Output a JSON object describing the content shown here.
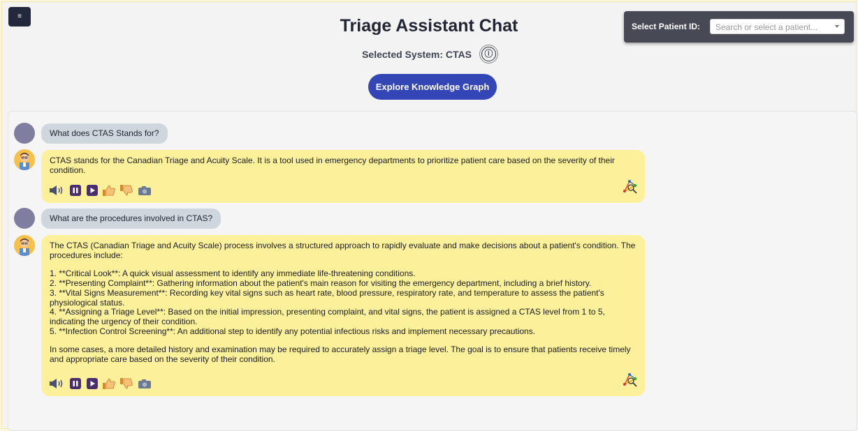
{
  "header": {
    "menu_label": "≡",
    "title": "Triage Assistant Chat",
    "system_label": "Selected System: CTAS",
    "info_glyph": "ⓘ",
    "kg_button": "Explore Knowledge Graph"
  },
  "patient": {
    "label": "Select Patient ID:",
    "placeholder": "Search or select a patient..."
  },
  "messages": [
    {
      "role": "user",
      "text": "What does CTAS Stands for?"
    },
    {
      "role": "assistant",
      "lines": [
        "CTAS stands for the Canadian Triage and Acuity Scale. It is a tool used in emergency departments to prioritize patient care based on the severity of their condition."
      ]
    },
    {
      "role": "user",
      "text": "What are the procedures involved in CTAS?"
    },
    {
      "role": "assistant",
      "intro": "The CTAS (Canadian Triage and Acuity Scale) process involves a structured approach to rapidly evaluate and make decisions about a patient's condition. The procedures include:",
      "items": [
        "1. **Critical Look**: A quick visual assessment to identify any immediate life-threatening conditions.",
        "2. **Presenting Complaint**: Gathering information about the patient's main reason for visiting the emergency department, including a brief history.",
        "3. **Vital Signs Measurement**: Recording key vital signs such as heart rate, blood pressure, respiratory rate, and temperature to assess the patient's physiological status.",
        "4. **Assigning a Triage Level**: Based on the initial impression, presenting complaint, and vital signs, the patient is assigned a CTAS level from 1 to 5, indicating the urgency of their condition.",
        "5. **Infection Control Screening**: An additional step to identify any potential infectious risks and implement necessary precautions."
      ],
      "outro": "In some cases, a more detailed history and examination may be required to accurately assign a triage level. The goal is to ensure that patients receive timely and appropriate care based on the severity of their condition."
    }
  ],
  "actions": [
    "speaker-icon",
    "pause-icon",
    "play-icon",
    "thumbs-up-icon",
    "thumbs-down-icon",
    "camera-icon"
  ],
  "colors": {
    "accent": "#3446b5",
    "assistant_bubble": "#fcf09a",
    "user_bubble": "#cfd6de",
    "user_avatar": "#7f7ea0",
    "header_panel": "#474a55"
  }
}
